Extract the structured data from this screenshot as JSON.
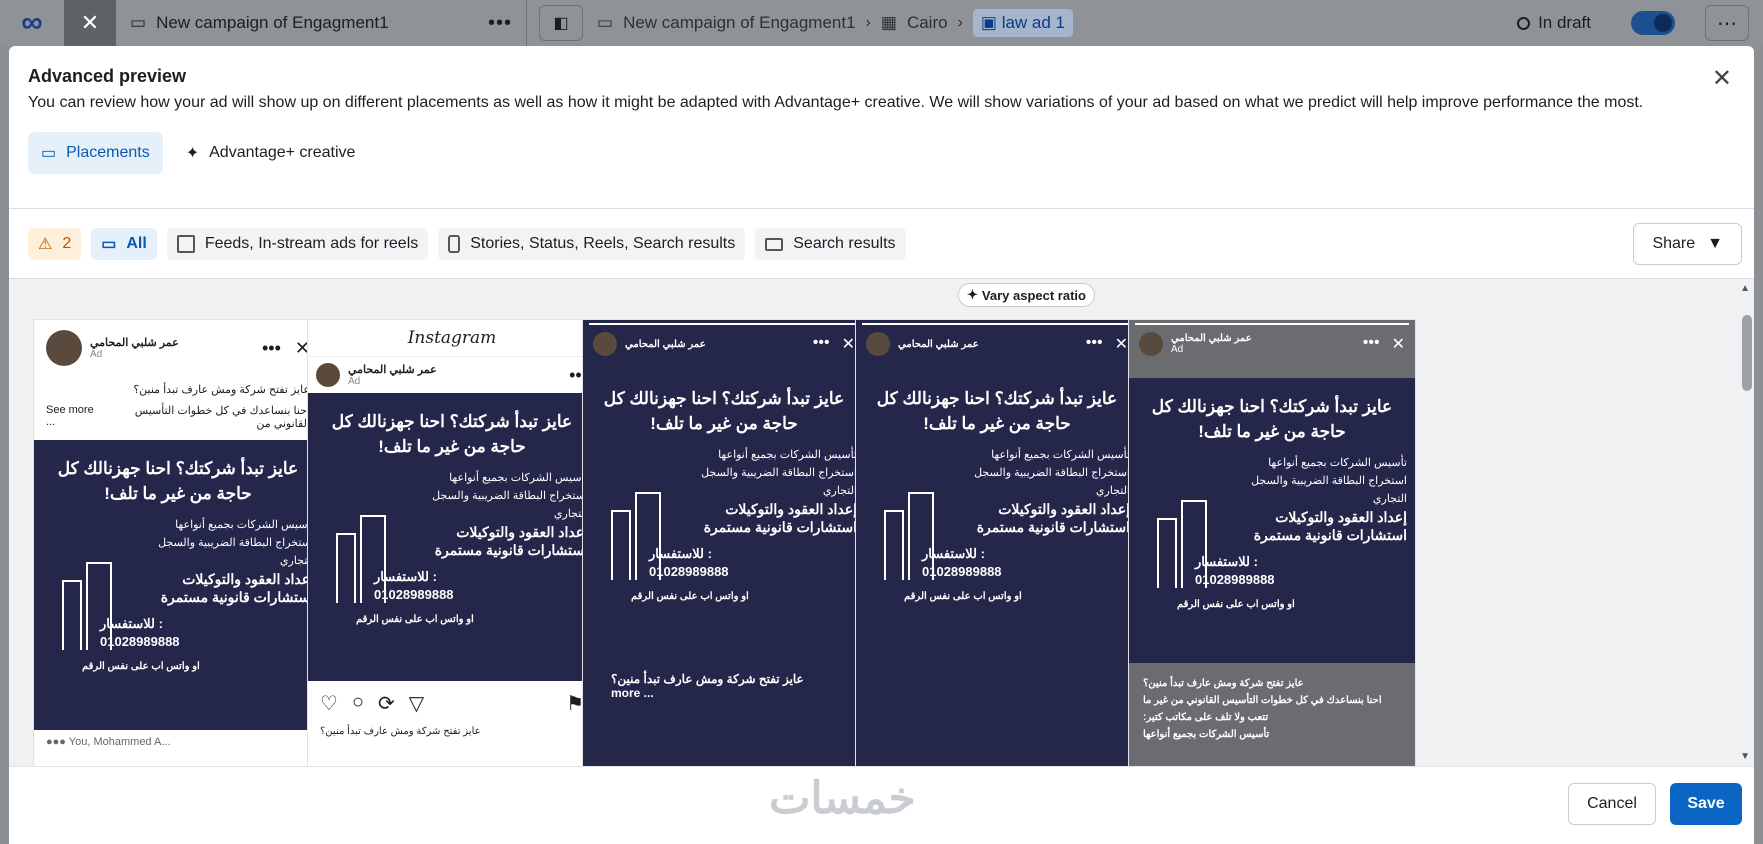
{
  "topbar": {
    "campaign_tab": "New campaign of Engagment1",
    "breadcrumbs": [
      "New campaign of Engagment1",
      "Cairo",
      "law ad 1"
    ],
    "status": "In draft"
  },
  "modal": {
    "title": "Advanced preview",
    "description": "You can review how your ad will show up on different placements as well as how it might be adapted with Advantage+ creative. We will show variations of your ad based on what we predict will help improve performance the most.",
    "tabs": {
      "placements": "Placements",
      "advantage": "Advantage+ creative"
    },
    "filters": {
      "warnings": "2",
      "all": "All",
      "feeds": "Feeds, In-stream ads for reels",
      "stories": "Stories, Status, Reels, Search results",
      "search": "Search results"
    },
    "share": "Share",
    "vary": "Vary aspect ratio"
  },
  "ad": {
    "page_name": "عمر شلبي المحامي",
    "ad_label": "Ad",
    "primary_text": "عايز تفتح شركة ومش عارف تبدأ منين؟",
    "second_line": "احنا بنساعدك في كل خطوات التأسيس القانوني من",
    "see_more": "See more ...",
    "more": "more ...",
    "headline": "عايز تبدأ شركتك؟ احنا جهزنالك كل حاجة من غير ما تلف!",
    "services": [
      "تأسيس الشركات بجميع أنواعها",
      "استخراج البطاقة الضريبية والسجل التجاري",
      "إعداد العقود والتوكيلات",
      "استشارات قانونية مستمرة"
    ],
    "contact_label": "للاستفسار :",
    "phone": "01028989888",
    "whatsapp": "او واتس اب على نفس الرقم",
    "caption_extra": "احنا بنساعدك في كل خطوات التأسيس القانوني من غير ما تتعب ولا تلف على مكاتب كتير:",
    "reactions": "You, Mohammed A..."
  },
  "instagram_logo": "Instagram",
  "footer": {
    "cancel": "Cancel",
    "save": "Save",
    "watermark": "خمسات"
  }
}
